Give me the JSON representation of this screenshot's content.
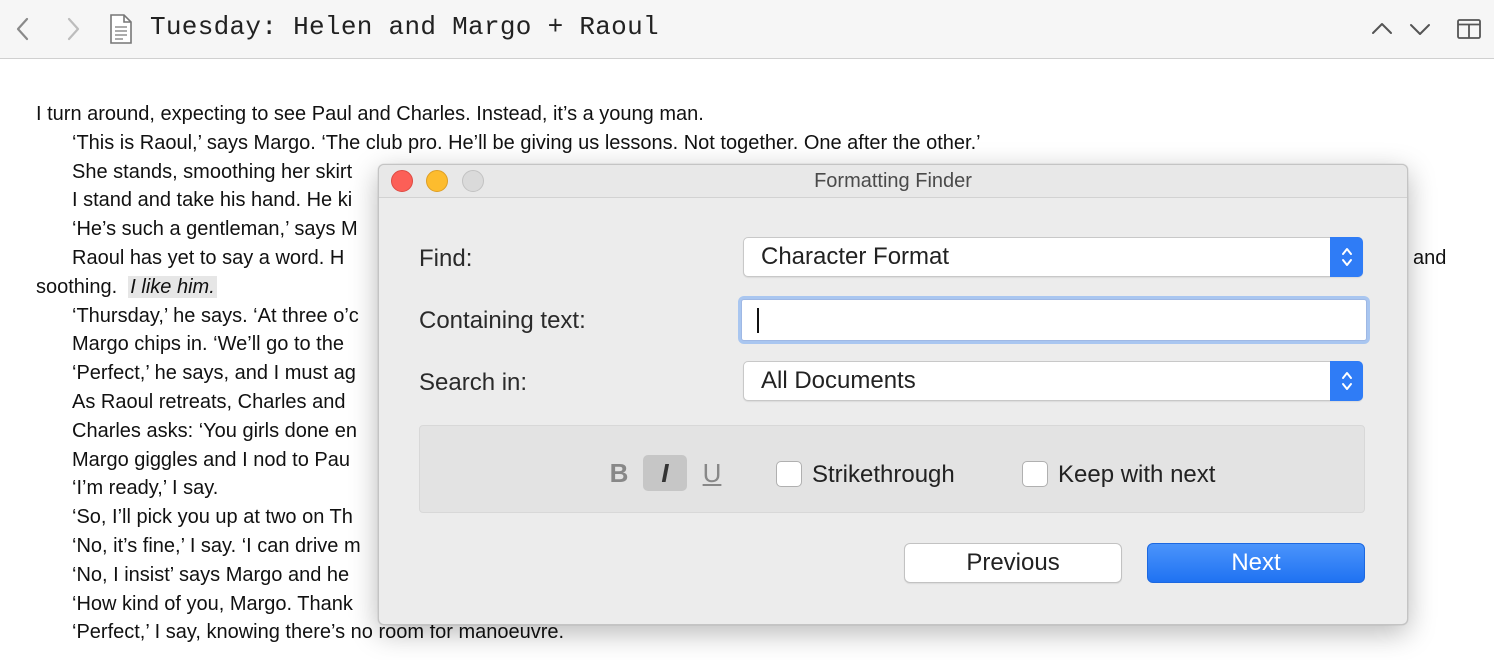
{
  "header": {
    "title": "Tuesday: Helen and Margo + Raoul",
    "icons": [
      "chevron-left-icon",
      "chevron-right-icon",
      "document-icon",
      "chevron-up-icon",
      "chevron-down-icon",
      "split-view-icon"
    ]
  },
  "editor": {
    "paragraphs": [
      "I turn around, expecting to see Paul and Charles. Instead, it’s a young man.",
      "‘This is Raoul,’ says Margo. ‘The club pro. He’ll be giving us lessons. Not together. One after the other.’",
      "She stands, smoothing her skirt",
      "I stand and take his hand. He ki",
      "‘He’s such a gentleman,’ says M",
      "‘Thursday,’ he says. ‘At three o’c",
      "Margo chips in. ‘We’ll go to the",
      "‘Perfect,’ he says, and I must ag",
      "As Raoul retreats, Charles and",
      "Charles asks: ‘You girls done en",
      "Margo giggles and I nod to Pau",
      "‘I’m ready,’ I say.",
      "‘So, I’ll pick you up at two on Th",
      "‘No, it’s fine,’ I say. ‘I can drive m",
      "‘No, I insist’ says Margo and he",
      "‘How kind of you, Margo. Thank",
      "‘Perfect,’ I say, knowing there’s no room for manoeuvre."
    ],
    "raoul_start": "Raoul has yet to say a word. H",
    "raoul_end": "and",
    "raoul_line2": "soothing.",
    "highlight": "I like him."
  },
  "dialog": {
    "title": "Formatting Finder",
    "find_label": "Find:",
    "find_value": "Character Format",
    "containing_label": "Containing text:",
    "containing_value": "",
    "search_label": "Search in:",
    "search_value": "All Documents",
    "bold": "B",
    "italic": "I",
    "underline": "U",
    "italic_selected": true,
    "strikethrough_label": "Strikethrough",
    "strikethrough_checked": false,
    "keep_label": "Keep with next",
    "keep_checked": false,
    "previous_label": "Previous",
    "next_label": "Next"
  },
  "colors": {
    "accent": "#2f7cf6",
    "close": "#fc5f57",
    "minimize": "#fdbc2e",
    "zoom_disabled": "#dadada",
    "highlight_bg": "#e6e6e6"
  }
}
